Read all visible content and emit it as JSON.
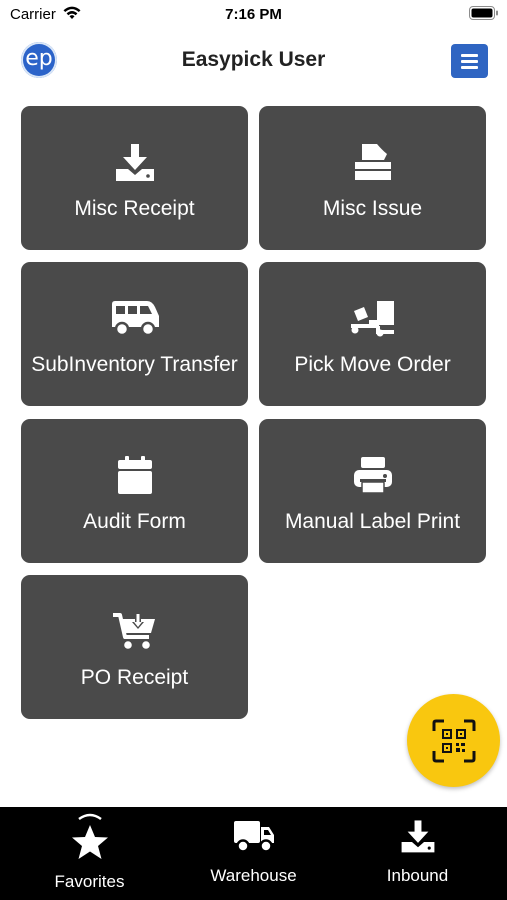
{
  "status_bar": {
    "carrier": "Carrier",
    "time": "7:16 PM"
  },
  "header": {
    "logo_text": "ep",
    "title": "Easypick User",
    "menu_icon": "hamburger-menu-icon"
  },
  "tiles": [
    {
      "label": "Misc Receipt",
      "icon": "download-tray-icon"
    },
    {
      "label": "Misc Issue",
      "icon": "tissue-box-icon"
    },
    {
      "label": "SubInventory Transfer",
      "icon": "shuttle-van-icon"
    },
    {
      "label": "Pick Move Order",
      "icon": "dolly-flatbed-icon"
    },
    {
      "label": "Audit Form",
      "icon": "calendar-icon"
    },
    {
      "label": "Manual Label Print",
      "icon": "printer-icon"
    },
    {
      "label": "PO Receipt",
      "icon": "cart-arrow-down-icon"
    }
  ],
  "fab": {
    "icon": "qr-scan-icon"
  },
  "bottom_nav": [
    {
      "label": "Favorites",
      "icon": "star-icon",
      "active": true
    },
    {
      "label": "Warehouse",
      "icon": "truck-icon"
    },
    {
      "label": "Inbound",
      "icon": "download-tray-icon"
    }
  ],
  "colors": {
    "tile_bg": "#4a4a4a",
    "accent_blue": "#2f65c2",
    "fab_yellow": "#f9c70f",
    "nav_bg": "#000000"
  }
}
